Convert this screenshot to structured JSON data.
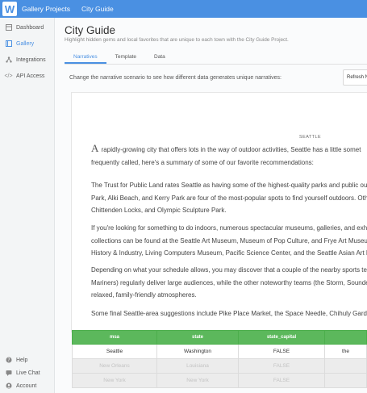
{
  "topbar": {
    "logo": "W",
    "project": "Gallery Projects",
    "current": "City Guide"
  },
  "sidebar": {
    "items": [
      {
        "label": "Dashboard",
        "icon": "dashboard-icon"
      },
      {
        "label": "Gallery",
        "icon": "gallery-icon"
      },
      {
        "label": "Integrations",
        "icon": "integrations-icon"
      },
      {
        "label": "API Access",
        "icon": "code-icon"
      }
    ],
    "bottom": [
      {
        "label": "Help",
        "icon": "help-icon"
      },
      {
        "label": "Live Chat",
        "icon": "chat-icon"
      },
      {
        "label": "Account",
        "icon": "account-icon"
      }
    ],
    "active_color": "#4a90e2"
  },
  "page": {
    "title": "City Guide",
    "subtitle": "Highlight hidden gems and local favorites that are unique to each town with the City Guide Project.",
    "tabs": [
      "Narratives",
      "Template",
      "Data"
    ]
  },
  "scenario": {
    "text": "Change the narrative scenario to see how different data generates unique narratives:",
    "button": "Refresh N"
  },
  "story": {
    "city": "SEATTLE",
    "p1": {
      "dropcap": "A",
      "l1": "rapidly-growing city that offers lots in the way of outdoor activities, Seattle has a little somet",
      "l2": "frequently called, here's a summary of some of our favorite recommendations:"
    },
    "p2": {
      "l1": "The Trust for Public Land rates Seattle as having some of the highest-quality parks and public outdo",
      "l2": "Park, Alki Beach, and Kerry Park are four of the most-popular spots to find yourself outdoors. Other c",
      "l3": "Chittenden Locks, and Olympic Sculpture Park."
    },
    "p3": {
      "l1": "If you're looking for something to do indoors, numerous spectacular museums, galleries, and exhibit",
      "l2": "collections can be found at the Seattle Art Museum, Museum of Pop Culture, and Frye Art Museum.",
      "l3": "History & Industry, Living Computers Museum, Pacific Science Center, and the Seattle Asian Art Mu"
    },
    "p4": {
      "l1": "Depending on what your schedule allows, you may discover that a couple of the nearby sports team",
      "l2": "Mariners) regularly deliver large audiences, while the other noteworthy teams (the Storm, Sounders",
      "l3": "relaxed, family-friendly atmospheres."
    },
    "p5": {
      "l1": "Some final Seattle-area suggestions include Pike Place Market, the Space Needle, Chihuly Garden ar"
    }
  },
  "table": {
    "headers": [
      "msa",
      "state",
      "state_capital",
      ""
    ],
    "rows": [
      [
        "Seattle",
        "Washington",
        "FALSE",
        "the"
      ],
      [
        "New Orleans",
        "Louisiana",
        "FALSE",
        ""
      ],
      [
        "New York",
        "New York",
        "FALSE",
        ""
      ]
    ],
    "header_color": "#5cb85c"
  }
}
